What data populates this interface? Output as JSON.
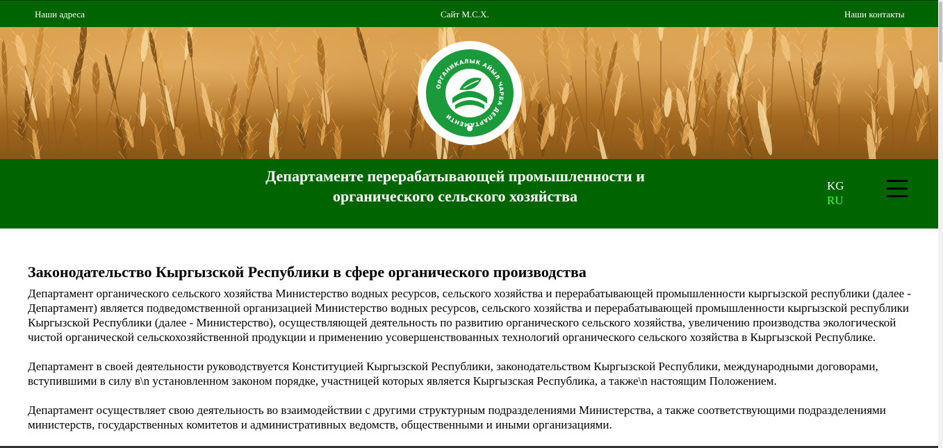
{
  "topbar": {
    "address_label": "Наши адреса",
    "site_label": "Сайт М.С.Х.",
    "contacts_label": "Наши контакты"
  },
  "hero": {
    "logo_icon": "organic-agriculture-department-logo",
    "logo_text": "ОРГАНИКАЛЫК АЙЫЛ ЧАРБА ДЕПАРТАМЕНТИ"
  },
  "band": {
    "title": "Департаменте перерабатывающей промышленности и органического сельского хозяйства",
    "lang_kg": "KG",
    "lang_ru": "RU",
    "menu_icon": "hamburger-menu-icon"
  },
  "content": {
    "heading": "Законодательство Кыргызской Республики в сфере органического производства",
    "paragraphs": [
      "Департамент органического сельского хозяйства Министерство водных ресурсов, сельского хозяйства и перерабатывающей промышленности кыргызской республики (далее - Департамент) является подведомственной организацией Министерство водных ресурсов, сельского хозяйства и перерабатывающей промышленности кыргызской республики Кыргызской Республики (далее - Министерство), осуществляющей деятельность по развитию органического сельского хозяйства, увеличению производства экологической чистой органической сельскохозяйственной продукции и применению усовершенствованных технологий органического сельского хозяйства в Кыргызской Республике.",
      "Департамент в своей деятельности руководствуется Конституцией Кыргызской Республики, законодательством Кыргызской Республики, международными договорами, вступившими в силу в\\n установленном законом порядке, участницей которых является Кыргызская Республика, а также\\n настоящим Положением.",
      "Департамент осуществляет свою деятельность во взаимодействии с другими структурным подразделениями Министерства, а также соответствующими подразделениями министерств, государственных комитетов и административных ведомств, общественными и иными организациями."
    ]
  },
  "colors": {
    "brand_green": "#006400",
    "active_lang": "#33ff33",
    "logo_green": "#1a9a3a"
  }
}
